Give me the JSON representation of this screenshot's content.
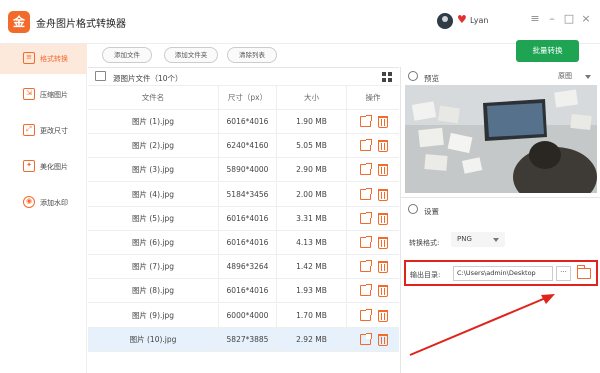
{
  "app": {
    "title": "金舟图片格式转换器",
    "logo_text": "金",
    "user": "Lyan",
    "window_controls": [
      "≡",
      "–",
      "□",
      "×"
    ]
  },
  "sidebar": {
    "items": [
      {
        "label": "格式转换",
        "icon": "convert-icon",
        "active": true
      },
      {
        "label": "压缩图片",
        "icon": "compress-icon",
        "active": false
      },
      {
        "label": "更改尺寸",
        "icon": "resize-icon",
        "active": false
      },
      {
        "label": "美化图片",
        "icon": "beautify-icon",
        "active": false
      },
      {
        "label": "添加水印",
        "icon": "watermark-icon",
        "active": false
      }
    ]
  },
  "toolbar": {
    "add_file": "添加文件",
    "add_folder": "添加文件夹",
    "clear_list": "清除列表",
    "batch_convert": "批量转换"
  },
  "file_table": {
    "source_label": "源图片文件（10个）",
    "columns": [
      "文件名",
      "尺寸（px）",
      "大小",
      "操作"
    ],
    "rows": [
      {
        "name": "图片 (1).jpg",
        "dim": "6016*4016",
        "size": "1.90 MB"
      },
      {
        "name": "图片 (2).jpg",
        "dim": "6240*4160",
        "size": "5.05 MB"
      },
      {
        "name": "图片 (3).jpg",
        "dim": "5890*4000",
        "size": "2.90 MB"
      },
      {
        "name": "图片 (4).jpg",
        "dim": "5184*3456",
        "size": "2.00 MB"
      },
      {
        "name": "图片 (5).jpg",
        "dim": "6016*4016",
        "size": "3.31 MB"
      },
      {
        "name": "图片 (6).jpg",
        "dim": "6016*4016",
        "size": "4.13 MB"
      },
      {
        "name": "图片 (7).jpg",
        "dim": "4896*3264",
        "size": "1.42 MB"
      },
      {
        "name": "图片 (8).jpg",
        "dim": "6016*4016",
        "size": "1.93 MB"
      },
      {
        "name": "图片 (9).jpg",
        "dim": "6000*4000",
        "size": "1.70 MB"
      },
      {
        "name": "图片 (10).jpg",
        "dim": "5827*3885",
        "size": "2.92 MB",
        "selected": true
      }
    ]
  },
  "preview": {
    "label": "预览",
    "background_option": "原图"
  },
  "settings": {
    "label": "设置",
    "format_label": "转换格式:",
    "format_value": "PNG",
    "output_label": "输出目录:",
    "output_path": "C:\\Users\\admin\\Desktop",
    "browse_label": "···"
  },
  "colors": {
    "accent": "#f26b2a",
    "primary_green": "#1ea453",
    "highlight_red": "#e0231c",
    "selected_row": "#e6f1fb"
  }
}
